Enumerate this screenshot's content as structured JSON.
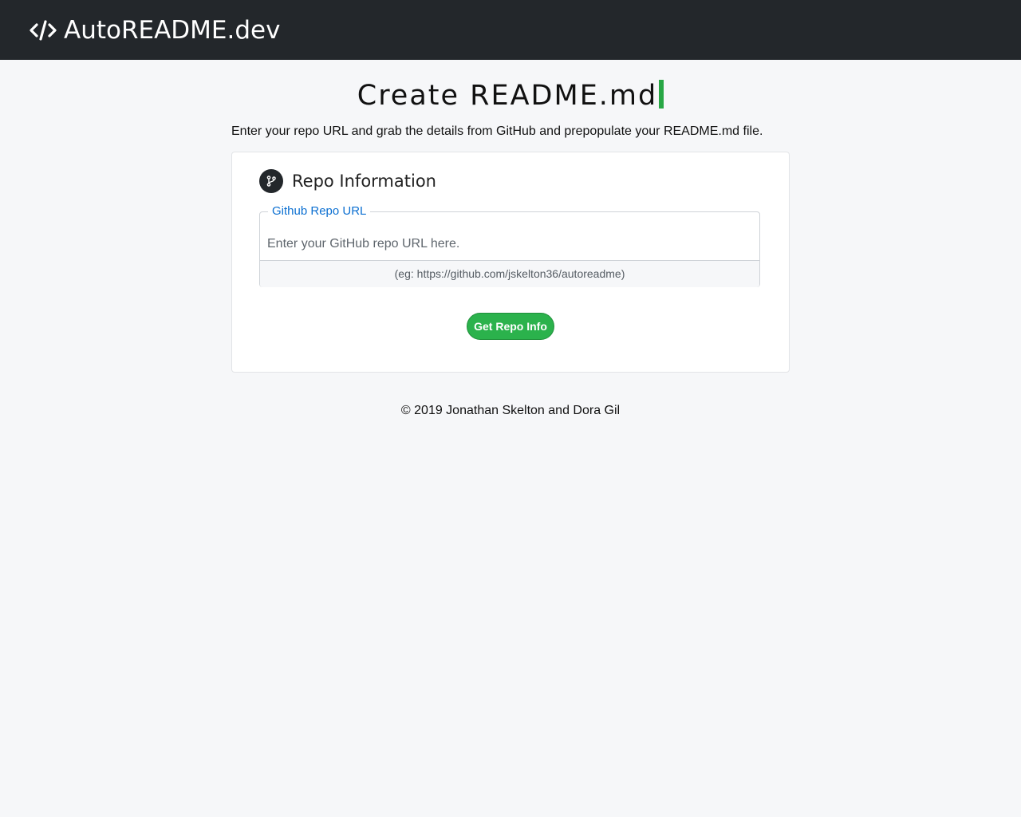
{
  "navbar": {
    "brand_text": "AutoREADME.dev",
    "brand_icon": "code-icon"
  },
  "page": {
    "title": "Create README.md",
    "lead": "Enter your repo URL and grab the details from GitHub and prepopulate your README.md file."
  },
  "card": {
    "header_icon": "git-branch-icon",
    "title": "Repo Information",
    "field": {
      "legend": "Github Repo URL",
      "value": "",
      "placeholder": "Enter your GitHub repo URL here.",
      "hint": "(eg: https://github.com/jskelton36/autoreadme)"
    },
    "button_label": "Get Repo Info"
  },
  "footer": {
    "text": "© 2019 Jonathan Skelton and Dora Gil"
  },
  "colors": {
    "navbar": "#23272b",
    "accent_green": "#28a745",
    "legend_blue": "#0b6fd1",
    "background": "#f6f7f9"
  }
}
